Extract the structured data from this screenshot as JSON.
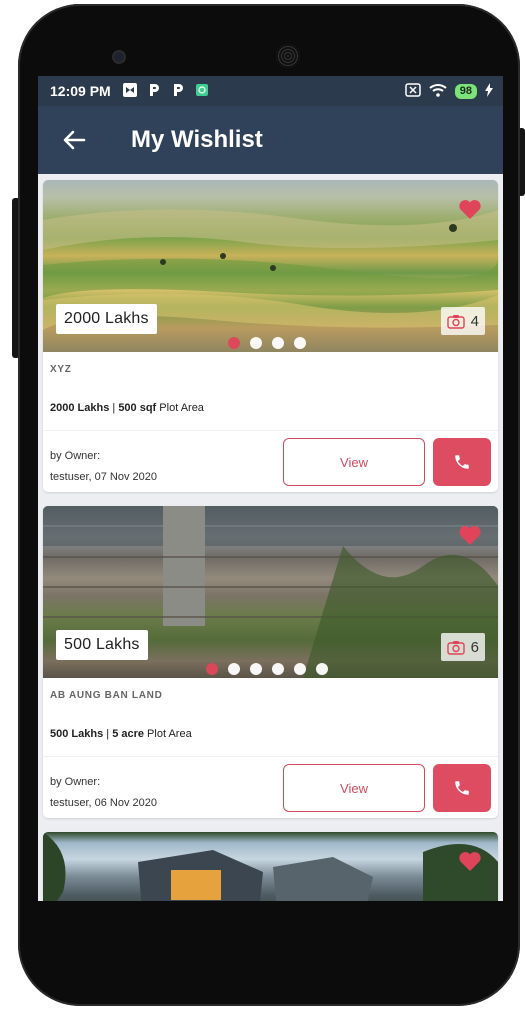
{
  "status_bar": {
    "time": "12:09 PM",
    "battery": "98"
  },
  "app_bar": {
    "title": "My Wishlist"
  },
  "colors": {
    "accent": "#de4c62",
    "app_bar": "#2f4259",
    "status_bar": "#2b3a4d"
  },
  "listings": [
    {
      "price_tag": "2000  Lakhs",
      "photo_count": "4",
      "name": "XYZ",
      "price": "2000 Lakhs",
      "separator": " | ",
      "area": "500 sqf",
      "area_suffix": " Plot Area",
      "owner_label": "by Owner:",
      "owner_info": "testuser, 07 Nov 2020",
      "view_label": "View",
      "dots_total": 4,
      "dot_active": 1
    },
    {
      "price_tag": "500  Lakhs",
      "photo_count": "6",
      "name": "AB AUNG BAN LAND",
      "price": "500 Lakhs",
      "separator": " | ",
      "area": "5 acre",
      "area_suffix": " Plot Area",
      "owner_label": "by Owner:",
      "owner_info": "testuser, 06 Nov 2020",
      "view_label": "View",
      "dots_total": 6,
      "dot_active": 1
    }
  ]
}
